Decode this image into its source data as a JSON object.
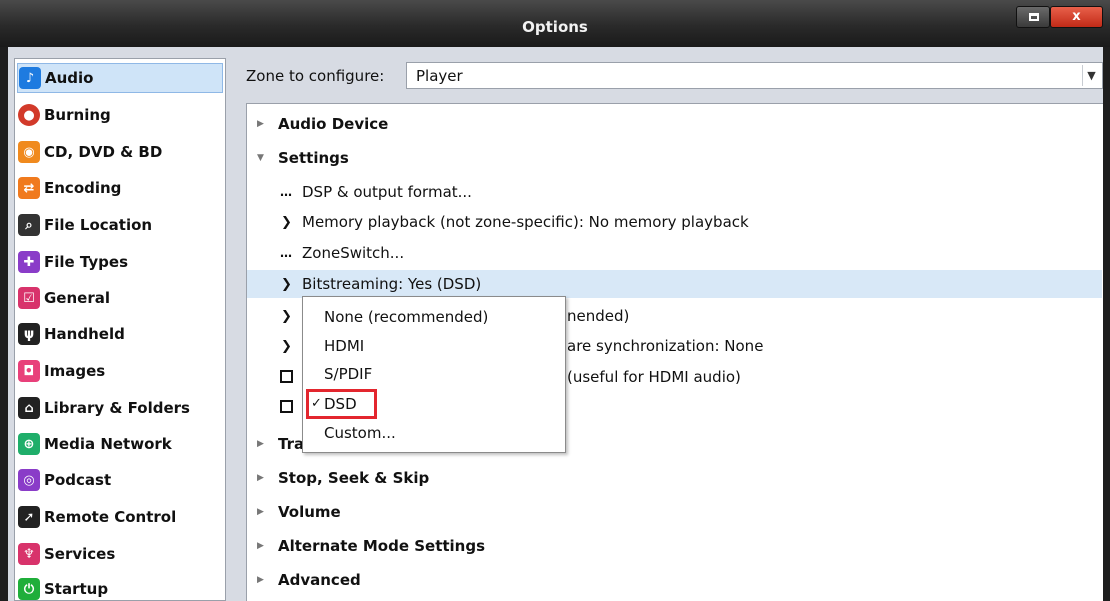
{
  "window": {
    "title": "Options",
    "minimize_icon": "minimize-icon",
    "close_label": "x",
    "colors": {
      "titlebar": "#2a2a2a",
      "close": "#c12a17",
      "selection": "#cfe4f8"
    }
  },
  "sidebar": {
    "items": [
      {
        "label": "Audio",
        "icon": "music-note-icon",
        "color": "#1e7be0",
        "selected": true
      },
      {
        "label": "Burning",
        "icon": "burning-icon",
        "color": "#d23a2a"
      },
      {
        "label": "CD, DVD & BD",
        "icon": "disc-icon",
        "color": "#f08a1e"
      },
      {
        "label": "Encoding",
        "icon": "encoding-icon",
        "color": "#f07a1e"
      },
      {
        "label": "File Location",
        "icon": "file-location-icon",
        "color": "#333333"
      },
      {
        "label": "File Types",
        "icon": "puzzle-icon",
        "color": "#8a3cc8"
      },
      {
        "label": "General",
        "icon": "checkbox-icon",
        "color": "#d8336b"
      },
      {
        "label": "Handheld",
        "icon": "usb-icon",
        "color": "#222222"
      },
      {
        "label": "Images",
        "icon": "camera-icon",
        "color": "#e8407a"
      },
      {
        "label": "Library & Folders",
        "icon": "home-icon",
        "color": "#222222"
      },
      {
        "label": "Media Network",
        "icon": "network-icon",
        "color": "#1fae6a"
      },
      {
        "label": "Podcast",
        "icon": "podcast-icon",
        "color": "#8a3cc8"
      },
      {
        "label": "Remote Control",
        "icon": "remote-icon",
        "color": "#222222"
      },
      {
        "label": "Services",
        "icon": "plug-icon",
        "color": "#d8336b"
      },
      {
        "label": "Startup",
        "icon": "power-icon",
        "color": "#1fae3a"
      }
    ]
  },
  "zone": {
    "label": "Zone to configure:",
    "value": "Player"
  },
  "tree": {
    "audio_device": "Audio Device",
    "settings": "Settings",
    "dsp": "DSP & output format...",
    "memory_playback": "Memory playback (not zone-specific): No memory playback",
    "zoneswitch": "ZoneSwitch...",
    "bitstreaming": "Bitstreaming: Yes (DSD)",
    "row_partial_1": "nended)",
    "row_partial_2": "are synchronization: None",
    "row_partial_3": "(useful for HDMI audio)",
    "track_partial": "Tra",
    "stop_seek_skip": "Stop, Seek & Skip",
    "volume": "Volume",
    "alternate_mode": "Alternate Mode Settings",
    "advanced": "Advanced"
  },
  "bitstreaming_dropdown": {
    "options": [
      "None (recommended)",
      "HDMI",
      "S/PDIF",
      "DSD",
      "Custom..."
    ],
    "selected": "DSD",
    "check_glyph": "✓"
  }
}
